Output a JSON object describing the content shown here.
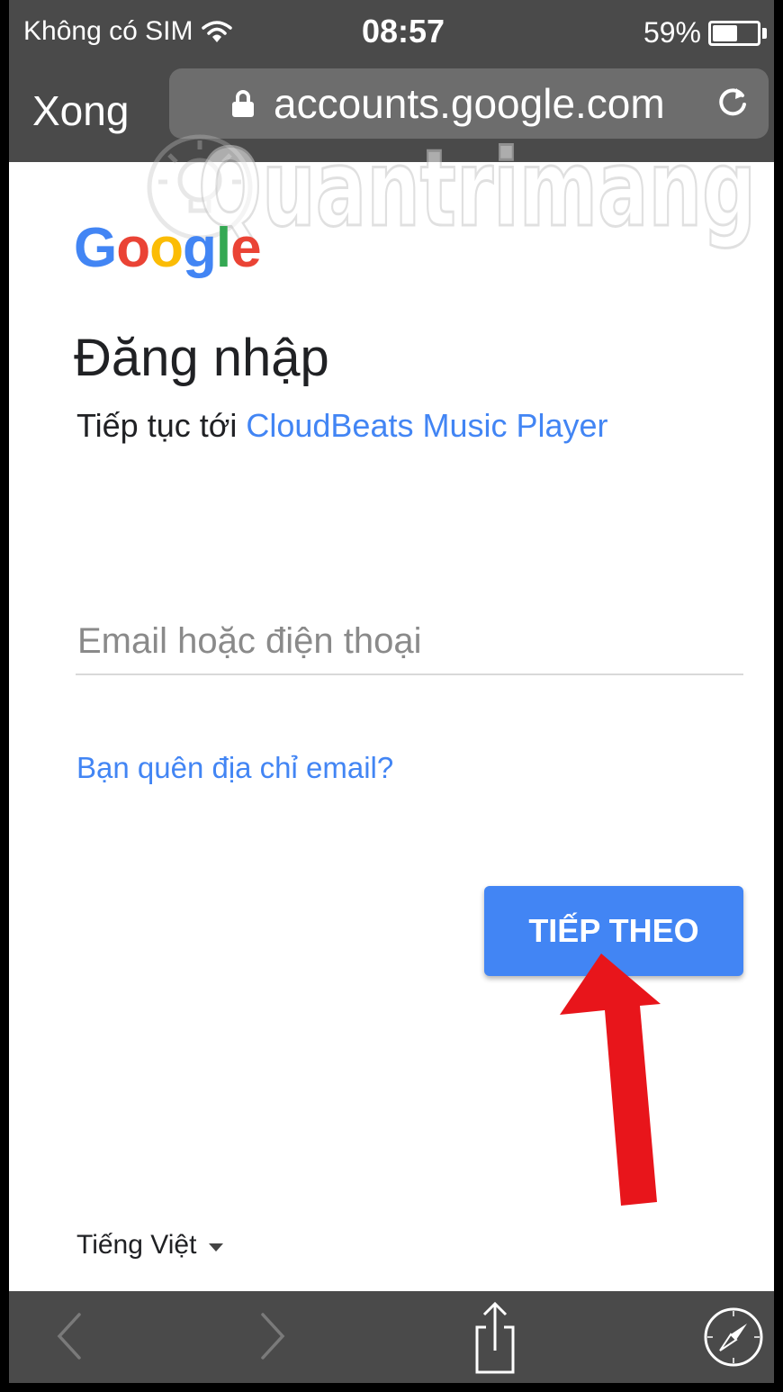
{
  "status_bar": {
    "carrier": "Không có SIM",
    "time": "08:57",
    "battery_text": "59%",
    "battery_level": 0.59
  },
  "url_bar": {
    "done_label": "Xong",
    "url": "accounts.google.com"
  },
  "watermark_text": "Quantrimang",
  "page": {
    "logo_text": "Google",
    "logo_colors": [
      "#4285f4",
      "#ea4335",
      "#fbbc05",
      "#4285f4",
      "#34a853",
      "#ea4335"
    ],
    "title": "Đăng nhập",
    "subtitle_prefix": "Tiếp tục tới",
    "subtitle_app": "CloudBeats Music Player",
    "email_placeholder": "Email hoặc điện thoại",
    "forgot_link": "Bạn quên địa chỉ email?",
    "next_button": "TIẾP THEO",
    "language": "Tiếng Việt"
  },
  "colors": {
    "accent": "#4285f4",
    "chrome": "#4a4a4a",
    "arrow": "#e8151b"
  },
  "icons": [
    "wifi-icon",
    "lock-icon",
    "reload-icon",
    "back-arrow-icon",
    "forward-arrow-icon",
    "share-icon",
    "compass-icon"
  ]
}
